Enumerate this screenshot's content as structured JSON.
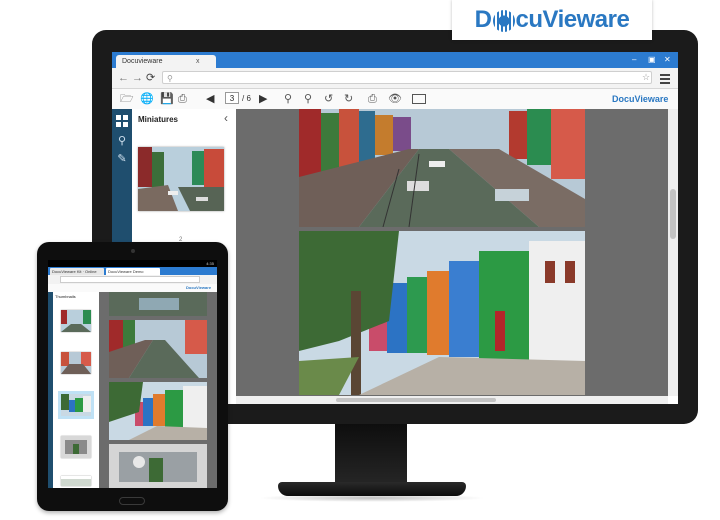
{
  "brand": {
    "logo_text_pre": "D",
    "logo_text_post": "cuVieware"
  },
  "monitor": {
    "browser": {
      "tab_title": "Docuvieware",
      "tab_close": "x",
      "url": "",
      "back_icon": "back-arrow-icon",
      "forward_icon": "forward-arrow-icon",
      "reload_icon": "reload-icon"
    },
    "toolbar": {
      "current_page": "3",
      "page_total": "/ 6",
      "logo_text": "DocuVieware"
    },
    "sidebar": {
      "panel_title": "Miniatures",
      "thumb_page_label": "2"
    },
    "document": {
      "pages": [
        "Burano canal photo",
        "Burano colorful houses photo"
      ]
    }
  },
  "tablet": {
    "status_time": "4:35",
    "tabs": [
      "DocuVieware Kit · Online",
      "DocuVieware Demo"
    ],
    "panel_title": "Thumbnails",
    "logo_text": "DocuVieware"
  },
  "colors": {
    "accent": "#2a78c2",
    "browser_blue": "#2c7bd0",
    "rail": "#1f4e6e",
    "doc_bg": "#6c6c6c"
  }
}
